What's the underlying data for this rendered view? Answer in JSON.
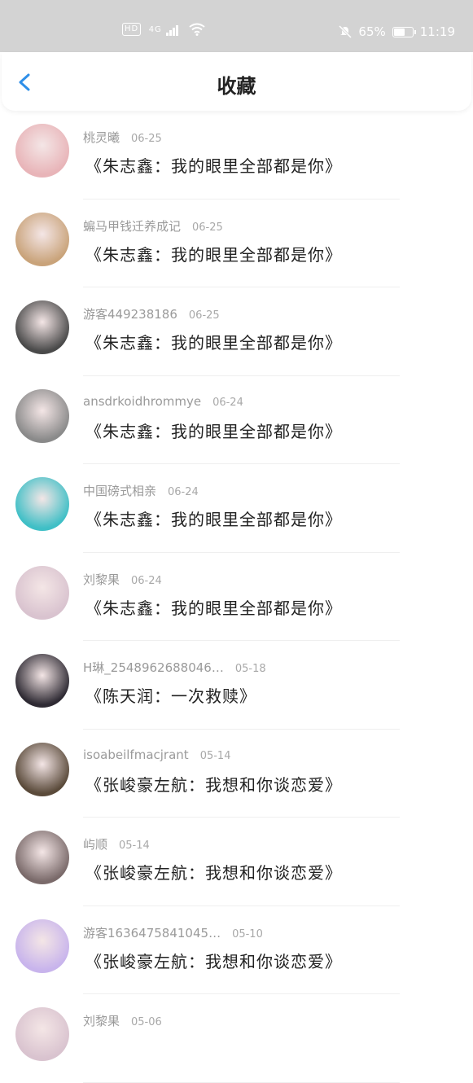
{
  "status_bar": {
    "hd": "HD",
    "network": "4G",
    "battery": "65%",
    "battery_level": 0.65,
    "time": "11:19"
  },
  "header": {
    "title": "收藏"
  },
  "items": [
    {
      "user": "桃灵曦",
      "date": "06-25",
      "song": "《朱志鑫：我的眼里全部都是你》",
      "avatar_color": "#e8b4b8"
    },
    {
      "user": "蝙马甲钱迁养成记",
      "date": "06-25",
      "song": "《朱志鑫：我的眼里全部都是你》",
      "avatar_color": "#c9a37a"
    },
    {
      "user": "游客449238186",
      "date": "06-25",
      "song": "《朱志鑫：我的眼里全部都是你》",
      "avatar_color": "#4a4a4a"
    },
    {
      "user": "ansdrkoidhrommye",
      "date": "06-24",
      "song": "《朱志鑫：我的眼里全部都是你》",
      "avatar_color": "#8a8a8a"
    },
    {
      "user": "中国磅式相亲",
      "date": "06-24",
      "song": "《朱志鑫：我的眼里全部都是你》",
      "avatar_color": "#3fbfc6"
    },
    {
      "user": "刘黎果",
      "date": "06-24",
      "song": "《朱志鑫：我的眼里全部都是你》",
      "avatar_color": "#d9c3cf"
    },
    {
      "user": "H琳_2548962688046…",
      "date": "05-18",
      "song": "《陈天润：一次救赎》",
      "avatar_color": "#2e2a33"
    },
    {
      "user": "isoabeilfmacjrant",
      "date": "05-14",
      "song": "《张峻豪左航：我想和你谈恋爱》",
      "avatar_color": "#5a4a3a"
    },
    {
      "user": "屿顺",
      "date": "05-14",
      "song": "《张峻豪左航：我想和你谈恋爱》",
      "avatar_color": "#7a6a6a"
    },
    {
      "user": "游客1636475841045…",
      "date": "05-10",
      "song": "《张峻豪左航：我想和你谈恋爱》",
      "avatar_color": "#c8b4ec"
    },
    {
      "user": "刘黎果",
      "date": "05-06",
      "song": "",
      "avatar_color": "#d9c3cf"
    }
  ]
}
